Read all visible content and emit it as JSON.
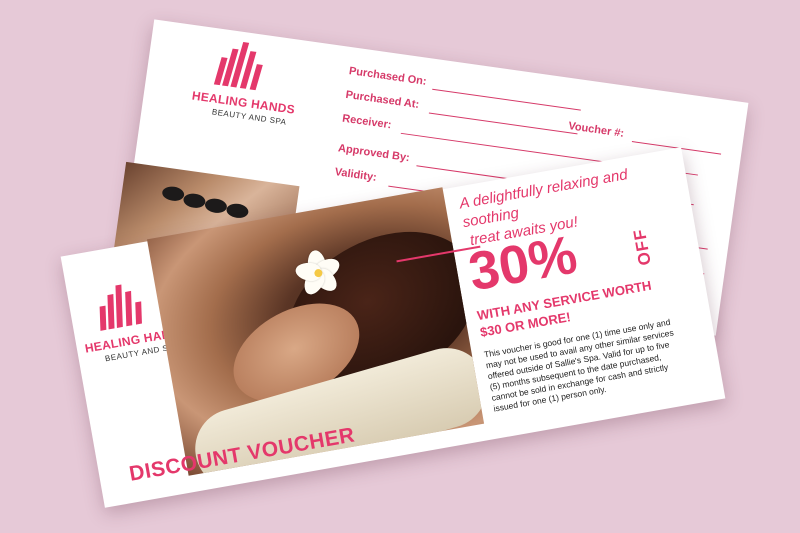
{
  "brand": {
    "name": "HEALING HANDS",
    "tagline": "BEAUTY AND SPA",
    "accent_color": "#e4386b"
  },
  "back_card": {
    "fields": [
      {
        "label": "Purchased On:"
      },
      {
        "label": "Purchased At:"
      },
      {
        "label": "Receiver:"
      },
      {
        "label": "Approved By:"
      },
      {
        "label": "Validity:"
      },
      {
        "label": "Voucher #:"
      }
    ]
  },
  "front_card": {
    "tagline_line1": "A delightfully relaxing and soothing",
    "tagline_line2": "treat awaits you!",
    "discount": "30%",
    "off_label": "OFF",
    "offer_line1": "WITH ANY SERVICE  WORTH",
    "offer_line2": "$30 OR MORE!",
    "terms": [
      "This voucher is good for one (1) time use only and",
      "may not be used to avail any other similar services",
      "offered outside of Sallie's Spa. Valid for up to five",
      "(5) months subsequent to the date purchased,",
      "cannot be sold in exchange for cash and strictly",
      "issued for one (1) person only."
    ],
    "title": "DISCOUNT VOUCHER"
  }
}
